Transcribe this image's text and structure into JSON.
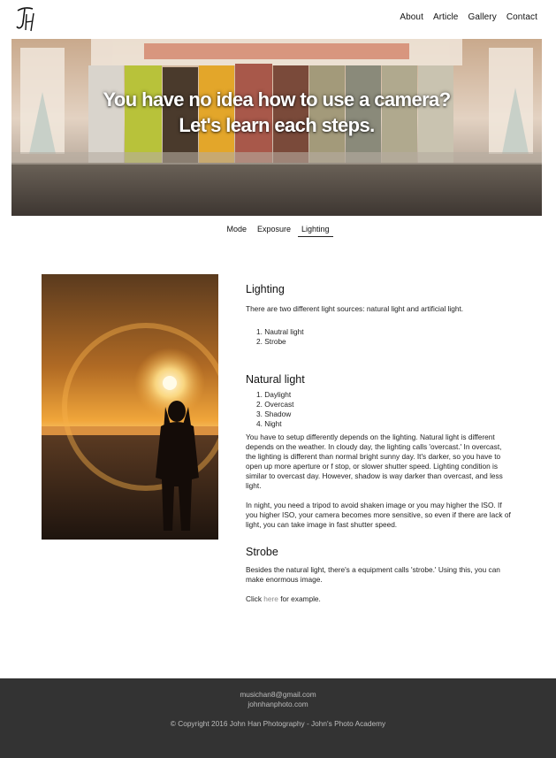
{
  "header": {
    "logo_alt": "JH",
    "nav": [
      "About",
      "Article",
      "Gallery",
      "Contact"
    ]
  },
  "hero": {
    "line1": "You have no idea how to use a camera?",
    "line2": "Let's learn each steps."
  },
  "tabs": {
    "items": [
      "Mode",
      "Exposure",
      "Lighting"
    ],
    "active": "Lighting"
  },
  "article": {
    "lighting_title": "Lighting",
    "lighting_intro": "There are two different light sources: natural light and artificial light.",
    "sources": [
      "1. Nautral light",
      "2. Strobe"
    ],
    "natural_title": "Natural light",
    "natural_list": [
      "1. Daylight",
      "2. Overcast",
      "3. Shadow",
      "4. Night"
    ],
    "natural_p1": "You have to setup differently depends on the lighting. Natural light is different depends on the weather. In cloudy day, the lighting calls 'overcast.' In overcast, the lighting is different than normal bright sunny day. It's darker, so you have to open up more aperture or f stop, or slower shutter speed. Lighting condition is similar to overcast day. However, shadow is way darker than overcast, and less light.",
    "natural_p2": "In night, you need a tripod to avoid shaken image or you may higher the ISO. If you higher ISO, your camera becomes more sensitive, so even if there are lack of light, you can take image in fast shutter speed.",
    "strobe_title": "Strobe",
    "strobe_p1": "Besides the natural light, there's a equipment calls 'strobe.' Using this, you can make enormous image.",
    "strobe_click_pre": "Click ",
    "strobe_click_link": "here",
    "strobe_click_post": " for example."
  },
  "footer": {
    "email": "musichan8@gmail.com",
    "site": "johnhanphoto.com",
    "copyright": "© Copyright 2016 John Han Photography - John's Photo Academy"
  },
  "colors": {
    "footer_bg": "#333333",
    "footer_text": "#bdbdbd",
    "link": "#8a8a8a"
  }
}
